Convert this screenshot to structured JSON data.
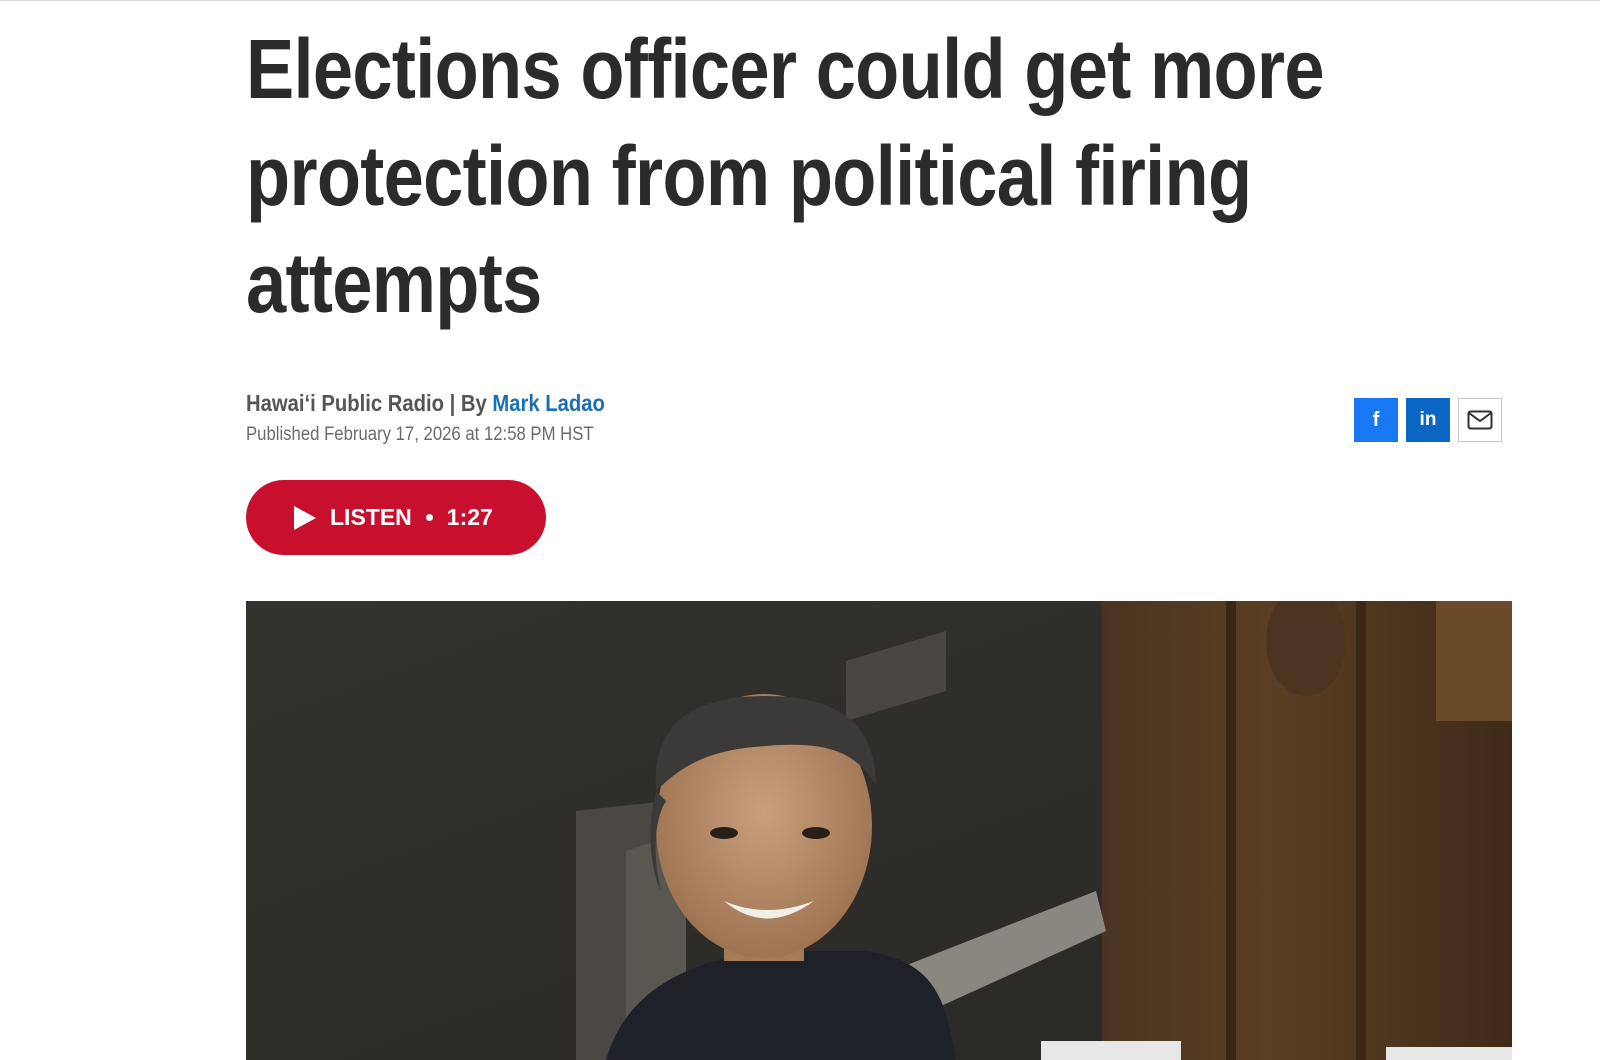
{
  "article": {
    "headline": "Elections officer could get more protection from political firing attempts",
    "source": "Hawaiʻi Public Radio",
    "byline_separator": " | By ",
    "author": "Mark Ladao",
    "published": "Published February 17, 2026 at 12:58 PM HST"
  },
  "share": {
    "facebook_icon": "f",
    "linkedin_icon": "in",
    "email_icon": "mail-icon"
  },
  "listen": {
    "label": "LISTEN",
    "duration": "1:27"
  },
  "colors": {
    "headline": "#2b2b2b",
    "author_link": "#1a6fb3",
    "listen_button": "#c8102e",
    "facebook": "#1877f2",
    "linkedin": "#0a66c2"
  }
}
